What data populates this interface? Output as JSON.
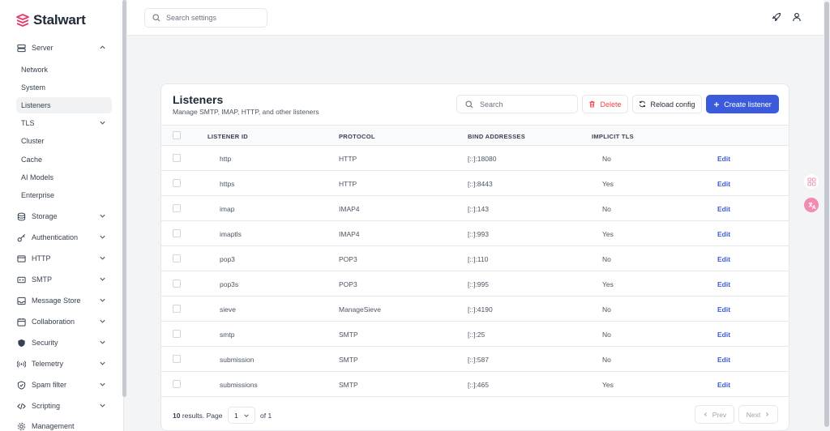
{
  "app": {
    "name": "Stalwart",
    "brand_color": "#e53e6b",
    "accent_color": "#3b5bdb"
  },
  "sidebar": {
    "server": {
      "label": "Server",
      "icon": "server-icon",
      "expanded": true
    },
    "sub_items": [
      {
        "label": "Network"
      },
      {
        "label": "System"
      },
      {
        "label": "Listeners",
        "active": true
      },
      {
        "label": "TLS",
        "has_chevron": true
      },
      {
        "label": "Cluster"
      },
      {
        "label": "Cache"
      },
      {
        "label": "AI Models"
      },
      {
        "label": "Enterprise"
      }
    ],
    "items": [
      {
        "label": "Storage",
        "icon": "database-icon"
      },
      {
        "label": "Authentication",
        "icon": "key-icon"
      },
      {
        "label": "HTTP",
        "icon": "http-icon"
      },
      {
        "label": "SMTP",
        "icon": "smtp-icon"
      },
      {
        "label": "Message Store",
        "icon": "inbox-icon"
      },
      {
        "label": "Collaboration",
        "icon": "calendar-icon"
      },
      {
        "label": "Security",
        "icon": "shield-icon"
      },
      {
        "label": "Telemetry",
        "icon": "signal-icon"
      },
      {
        "label": "Spam filter",
        "icon": "shield-check-icon"
      },
      {
        "label": "Scripting",
        "icon": "code-icon"
      },
      {
        "label": "Management",
        "icon": "gear-icon"
      }
    ]
  },
  "topbar": {
    "search_placeholder": "Search settings"
  },
  "listeners": {
    "title": "Listeners",
    "subtitle": "Manage SMTP, IMAP, HTTP, and other listeners",
    "search_placeholder": "Search",
    "delete_label": "Delete",
    "reload_label": "Reload config",
    "create_label": "Create listener",
    "columns": [
      "LISTENER ID",
      "PROTOCOL",
      "BIND ADDRESSES",
      "IMPLICIT TLS"
    ],
    "edit_label": "Edit",
    "rows": [
      {
        "id": "http",
        "protocol": "HTTP",
        "bind": "[::]:18080",
        "tls": "No"
      },
      {
        "id": "https",
        "protocol": "HTTP",
        "bind": "[::]:8443",
        "tls": "Yes"
      },
      {
        "id": "imap",
        "protocol": "IMAP4",
        "bind": "[::]:143",
        "tls": "No"
      },
      {
        "id": "imaptls",
        "protocol": "IMAP4",
        "bind": "[::]:993",
        "tls": "Yes"
      },
      {
        "id": "pop3",
        "protocol": "POP3",
        "bind": "[::]:110",
        "tls": "No"
      },
      {
        "id": "pop3s",
        "protocol": "POP3",
        "bind": "[::]:995",
        "tls": "Yes"
      },
      {
        "id": "sieve",
        "protocol": "ManageSieve",
        "bind": "[::]:4190",
        "tls": "No"
      },
      {
        "id": "smtp",
        "protocol": "SMTP",
        "bind": "[::]:25",
        "tls": "No"
      },
      {
        "id": "submission",
        "protocol": "SMTP",
        "bind": "[::]:587",
        "tls": "No"
      },
      {
        "id": "submissions",
        "protocol": "SMTP",
        "bind": "[::]:465",
        "tls": "Yes"
      }
    ],
    "footer": {
      "count": "10",
      "results_text": "results. Page",
      "page": "1",
      "of_text": "of 1",
      "prev_label": "Prev",
      "next_label": "Next"
    }
  }
}
